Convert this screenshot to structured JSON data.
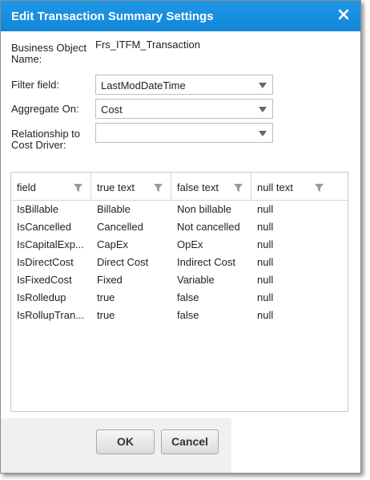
{
  "dialog": {
    "title": "Edit Transaction Summary Settings",
    "accent": "#1a8fe0"
  },
  "form": {
    "business_object_label": "Business Object Name:",
    "business_object_value": "Frs_ITFM_Transaction",
    "filter_label": "Filter field:",
    "filter_value": "LastModDateTime",
    "aggregate_label": "Aggregate On:",
    "aggregate_value": "Cost",
    "relationship_label": "Relationship to Cost Driver:",
    "relationship_value": ""
  },
  "grid": {
    "columns": [
      "field",
      "true text",
      "false text",
      "null text"
    ],
    "rows": [
      [
        "IsBillable",
        "Billable",
        "Non billable",
        "null"
      ],
      [
        "IsCancelled",
        "Cancelled",
        "Not cancelled",
        "null"
      ],
      [
        "IsCapitalExp...",
        "CapEx",
        "OpEx",
        "null"
      ],
      [
        "IsDirectCost",
        "Direct Cost",
        "Indirect Cost",
        "null"
      ],
      [
        "IsFixedCost",
        "Fixed",
        "Variable",
        "null"
      ],
      [
        "IsRolledup",
        "true",
        "false",
        "null"
      ],
      [
        "IsRollupTran...",
        "true",
        "false",
        "null"
      ]
    ]
  },
  "buttons": {
    "ok": "OK",
    "cancel": "Cancel"
  }
}
